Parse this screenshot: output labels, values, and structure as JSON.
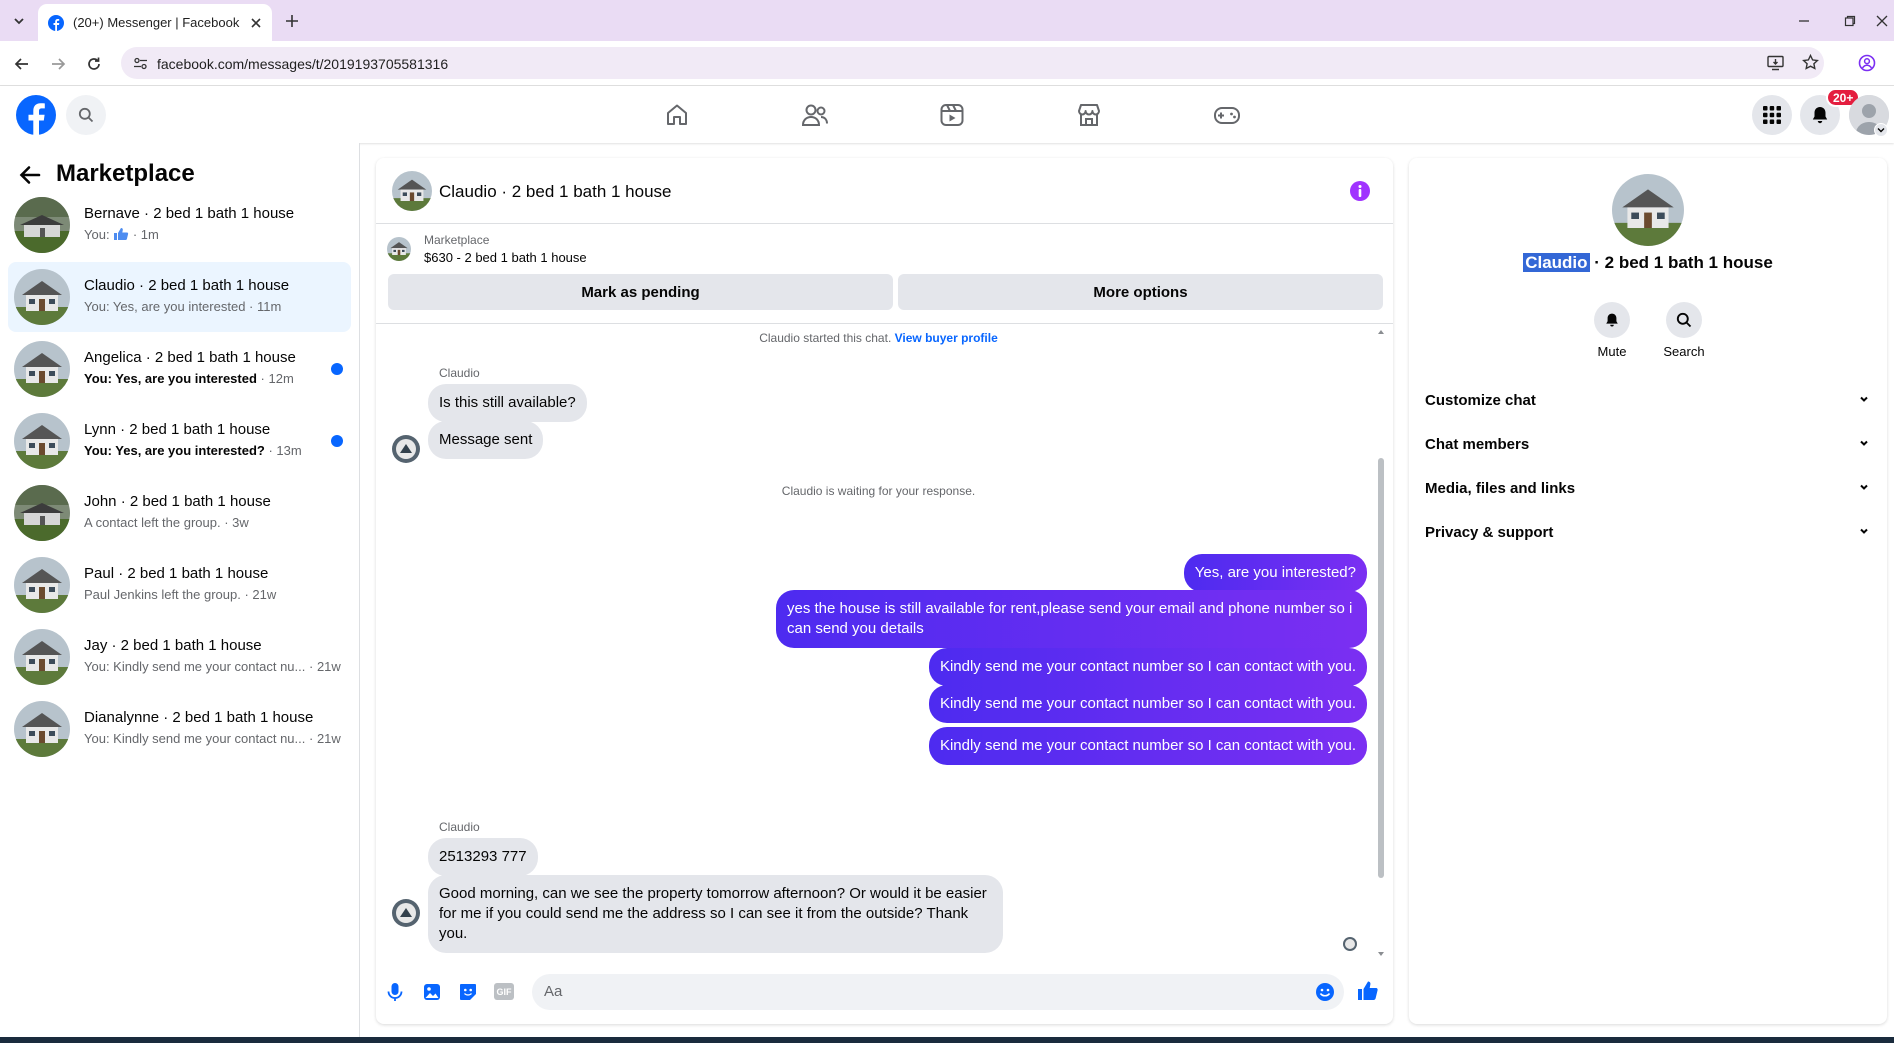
{
  "browser": {
    "tab_title": "(20+) Messenger | Facebook",
    "url": "facebook.com/messages/t/2019193705581316"
  },
  "header": {
    "notification_badge": "20+"
  },
  "sidebar": {
    "title": "Marketplace",
    "conversations": [
      {
        "name": "Bernave · 2 bed 1 bath 1 house",
        "preview_prefix": "You:",
        "preview": "",
        "time": "· 1m",
        "unread": false,
        "active": false,
        "thumb": "dark"
      },
      {
        "name": "Claudio · 2 bed 1 bath 1 house",
        "preview": "You: Yes, are you interested",
        "time": "· 11m",
        "unread": false,
        "active": true,
        "thumb": "house"
      },
      {
        "name": "Angelica · 2 bed 1 bath 1 house",
        "preview": "You: Yes, are you interested",
        "time": "· 12m",
        "unread": true,
        "active": false,
        "thumb": "house"
      },
      {
        "name": "Lynn · 2 bed 1 bath 1 house",
        "preview": "You: Yes, are you interested?",
        "time": "· 13m",
        "unread": true,
        "active": false,
        "thumb": "house"
      },
      {
        "name": "John · 2 bed 1 bath 1 house",
        "preview": "A contact left the group.",
        "time": "· 3w",
        "unread": false,
        "active": false,
        "thumb": "dark"
      },
      {
        "name": "Paul · 2 bed 1 bath 1 house",
        "preview": "Paul Jenkins left the group.",
        "time": "· 21w",
        "unread": false,
        "active": false,
        "thumb": "house"
      },
      {
        "name": "Jay · 2 bed 1 bath 1 house",
        "preview": "You: Kindly send me your contact nu...",
        "time": "· 21w",
        "unread": false,
        "active": false,
        "thumb": "house"
      },
      {
        "name": "Dianalynne · 2 bed 1 bath 1 house",
        "preview": "You: Kindly send me your contact nu...",
        "time": "· 21w",
        "unread": false,
        "active": false,
        "thumb": "house"
      }
    ]
  },
  "chat": {
    "title": "Claudio · 2 bed 1 bath 1 house",
    "listing_label": "Marketplace",
    "listing_detail": "$630 - 2 bed 1 bath 1 house",
    "mark_pending": "Mark as pending",
    "more_options": "More options",
    "started_text": "Claudio started this chat.",
    "view_profile": "View buyer profile",
    "waiting_text": "Claudio is waiting for your response.",
    "sender_name": "Claudio",
    "in_msg_1": "Is this still available?",
    "in_msg_2": "Message sent",
    "out_msg_1": "Yes, are you interested?",
    "out_msg_2": "yes the house is still available for rent,please send your email and phone number so i can send you details",
    "out_msg_3": "Kindly send me your contact number so I can contact with you.",
    "out_msg_4": "Kindly send me your contact number so I can contact with you.",
    "out_msg_5": "Kindly send me your contact number so I can contact with you.",
    "in_msg_3": "2513293 777",
    "in_msg_4": "Good morning, can we see the property tomorrow afternoon? Or would it be easier for me if you could send me the address so I can see it from the outside? Thank you.",
    "input_placeholder": "Aa",
    "gif_label": "GIF"
  },
  "details": {
    "name_highlight": "Claudio",
    "name_rest": "· 2 bed 1 bath 1 house",
    "mute": "Mute",
    "search": "Search",
    "sections": [
      "Customize chat",
      "Chat members",
      "Media, files and links",
      "Privacy & support"
    ]
  },
  "colors": {
    "accent": "#0866ff",
    "outgoing_start": "#4d2bf0",
    "outgoing_end": "#7b2ff2",
    "info": "#a033ff"
  }
}
